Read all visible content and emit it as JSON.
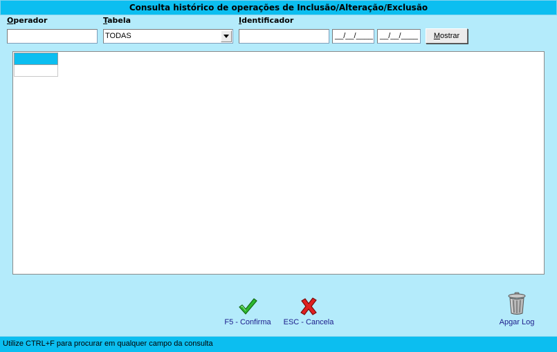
{
  "window": {
    "title": "Consulta histórico de operações de Inclusão/Alteração/Exclusão"
  },
  "filters": {
    "operador": {
      "label_hotkey": "O",
      "label_rest": "perador",
      "value": ""
    },
    "tabela": {
      "label_hotkey": "T",
      "label_rest": "abela",
      "selected": "TODAS"
    },
    "identificador": {
      "label_hotkey": "I",
      "label_rest": "dentificador",
      "value": ""
    },
    "date_from": {
      "value": "__/__/____"
    },
    "date_to": {
      "value": "__/__/____"
    },
    "mostrar": {
      "label_hotkey": "M",
      "label_rest": "ostrar"
    }
  },
  "actions": {
    "confirm": {
      "label": "F5 - Confirma",
      "icon": "checkmark-icon",
      "color": "#2eb82e"
    },
    "cancel": {
      "label": "ESC - Cancela",
      "icon": "x-icon",
      "color": "#e02020"
    },
    "clear_log": {
      "label": "Apgar Log",
      "icon": "trash-can-icon"
    }
  },
  "status_bar": {
    "text": "Utilize CTRL+F  para procurar em qualquer campo da consulta"
  },
  "colors": {
    "background": "#b4ebfb",
    "accent": "#0cbef0",
    "link_text": "#1a1a8a"
  }
}
